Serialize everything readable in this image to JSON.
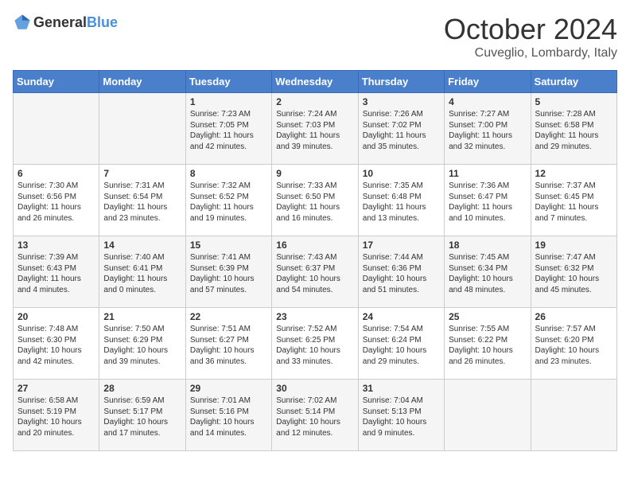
{
  "header": {
    "logo_general": "General",
    "logo_blue": "Blue",
    "month": "October 2024",
    "location": "Cuveglio, Lombardy, Italy"
  },
  "days_of_week": [
    "Sunday",
    "Monday",
    "Tuesday",
    "Wednesday",
    "Thursday",
    "Friday",
    "Saturday"
  ],
  "weeks": [
    [
      {
        "day": "",
        "content": ""
      },
      {
        "day": "",
        "content": ""
      },
      {
        "day": "1",
        "content": "Sunrise: 7:23 AM\nSunset: 7:05 PM\nDaylight: 11 hours and 42 minutes."
      },
      {
        "day": "2",
        "content": "Sunrise: 7:24 AM\nSunset: 7:03 PM\nDaylight: 11 hours and 39 minutes."
      },
      {
        "day": "3",
        "content": "Sunrise: 7:26 AM\nSunset: 7:02 PM\nDaylight: 11 hours and 35 minutes."
      },
      {
        "day": "4",
        "content": "Sunrise: 7:27 AM\nSunset: 7:00 PM\nDaylight: 11 hours and 32 minutes."
      },
      {
        "day": "5",
        "content": "Sunrise: 7:28 AM\nSunset: 6:58 PM\nDaylight: 11 hours and 29 minutes."
      }
    ],
    [
      {
        "day": "6",
        "content": "Sunrise: 7:30 AM\nSunset: 6:56 PM\nDaylight: 11 hours and 26 minutes."
      },
      {
        "day": "7",
        "content": "Sunrise: 7:31 AM\nSunset: 6:54 PM\nDaylight: 11 hours and 23 minutes."
      },
      {
        "day": "8",
        "content": "Sunrise: 7:32 AM\nSunset: 6:52 PM\nDaylight: 11 hours and 19 minutes."
      },
      {
        "day": "9",
        "content": "Sunrise: 7:33 AM\nSunset: 6:50 PM\nDaylight: 11 hours and 16 minutes."
      },
      {
        "day": "10",
        "content": "Sunrise: 7:35 AM\nSunset: 6:48 PM\nDaylight: 11 hours and 13 minutes."
      },
      {
        "day": "11",
        "content": "Sunrise: 7:36 AM\nSunset: 6:47 PM\nDaylight: 11 hours and 10 minutes."
      },
      {
        "day": "12",
        "content": "Sunrise: 7:37 AM\nSunset: 6:45 PM\nDaylight: 11 hours and 7 minutes."
      }
    ],
    [
      {
        "day": "13",
        "content": "Sunrise: 7:39 AM\nSunset: 6:43 PM\nDaylight: 11 hours and 4 minutes."
      },
      {
        "day": "14",
        "content": "Sunrise: 7:40 AM\nSunset: 6:41 PM\nDaylight: 11 hours and 0 minutes."
      },
      {
        "day": "15",
        "content": "Sunrise: 7:41 AM\nSunset: 6:39 PM\nDaylight: 10 hours and 57 minutes."
      },
      {
        "day": "16",
        "content": "Sunrise: 7:43 AM\nSunset: 6:37 PM\nDaylight: 10 hours and 54 minutes."
      },
      {
        "day": "17",
        "content": "Sunrise: 7:44 AM\nSunset: 6:36 PM\nDaylight: 10 hours and 51 minutes."
      },
      {
        "day": "18",
        "content": "Sunrise: 7:45 AM\nSunset: 6:34 PM\nDaylight: 10 hours and 48 minutes."
      },
      {
        "day": "19",
        "content": "Sunrise: 7:47 AM\nSunset: 6:32 PM\nDaylight: 10 hours and 45 minutes."
      }
    ],
    [
      {
        "day": "20",
        "content": "Sunrise: 7:48 AM\nSunset: 6:30 PM\nDaylight: 10 hours and 42 minutes."
      },
      {
        "day": "21",
        "content": "Sunrise: 7:50 AM\nSunset: 6:29 PM\nDaylight: 10 hours and 39 minutes."
      },
      {
        "day": "22",
        "content": "Sunrise: 7:51 AM\nSunset: 6:27 PM\nDaylight: 10 hours and 36 minutes."
      },
      {
        "day": "23",
        "content": "Sunrise: 7:52 AM\nSunset: 6:25 PM\nDaylight: 10 hours and 33 minutes."
      },
      {
        "day": "24",
        "content": "Sunrise: 7:54 AM\nSunset: 6:24 PM\nDaylight: 10 hours and 29 minutes."
      },
      {
        "day": "25",
        "content": "Sunrise: 7:55 AM\nSunset: 6:22 PM\nDaylight: 10 hours and 26 minutes."
      },
      {
        "day": "26",
        "content": "Sunrise: 7:57 AM\nSunset: 6:20 PM\nDaylight: 10 hours and 23 minutes."
      }
    ],
    [
      {
        "day": "27",
        "content": "Sunrise: 6:58 AM\nSunset: 5:19 PM\nDaylight: 10 hours and 20 minutes."
      },
      {
        "day": "28",
        "content": "Sunrise: 6:59 AM\nSunset: 5:17 PM\nDaylight: 10 hours and 17 minutes."
      },
      {
        "day": "29",
        "content": "Sunrise: 7:01 AM\nSunset: 5:16 PM\nDaylight: 10 hours and 14 minutes."
      },
      {
        "day": "30",
        "content": "Sunrise: 7:02 AM\nSunset: 5:14 PM\nDaylight: 10 hours and 12 minutes."
      },
      {
        "day": "31",
        "content": "Sunrise: 7:04 AM\nSunset: 5:13 PM\nDaylight: 10 hours and 9 minutes."
      },
      {
        "day": "",
        "content": ""
      },
      {
        "day": "",
        "content": ""
      }
    ]
  ]
}
